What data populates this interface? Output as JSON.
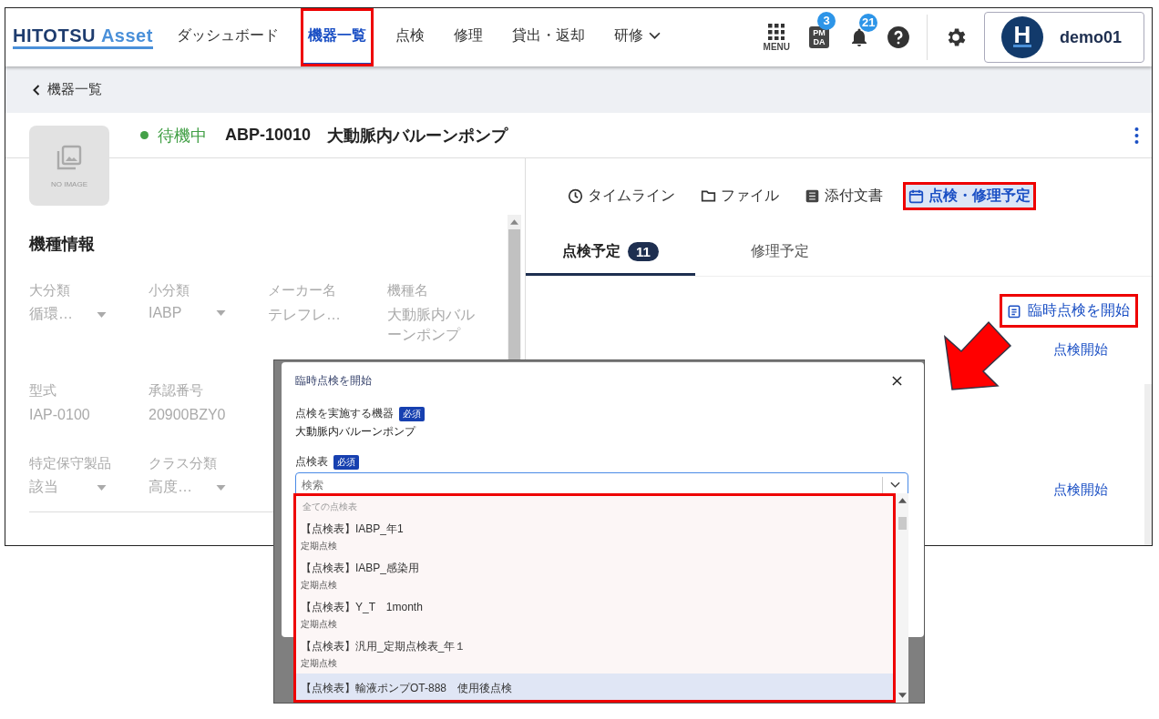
{
  "header": {
    "logo": {
      "main": "HITOTSU",
      "accent": "Asset"
    },
    "nav": [
      {
        "label": "ダッシュボード",
        "kind": "link",
        "selected": false,
        "highlighted": false
      },
      {
        "label": "機器一覧",
        "kind": "link",
        "selected": true,
        "highlighted": true
      },
      {
        "label": "点検",
        "kind": "link",
        "selected": false,
        "highlighted": false
      },
      {
        "label": "修理",
        "kind": "link",
        "selected": false,
        "highlighted": false
      },
      {
        "label": "貸出・返却",
        "kind": "link",
        "selected": false,
        "highlighted": false
      },
      {
        "label": "研修",
        "kind": "dropdown",
        "selected": false,
        "highlighted": false
      }
    ],
    "menu_label": "MENU",
    "pmda": {
      "lines": [
        "PM",
        "DA"
      ],
      "count": "3"
    },
    "notifications": {
      "count": "21"
    },
    "user": {
      "avatar_letter": "H",
      "name": "demo01"
    }
  },
  "breadcrumb": {
    "back": "機器一覧"
  },
  "device": {
    "status": {
      "label": "待機中",
      "color": "#43a047"
    },
    "code": "ABP-10010",
    "name": "大動脈内バルーンポンプ",
    "image_placeholder": "NO IMAGE"
  },
  "model_info": {
    "title": "機種情報",
    "rows": [
      [
        {
          "label": "大分類",
          "value": "循環…",
          "kind": "select"
        },
        {
          "label": "小分類",
          "value": "IABP",
          "kind": "select"
        },
        {
          "label": "メーカー名",
          "value": "テレフレ…",
          "kind": "text"
        },
        {
          "label": "機種名",
          "value": "大動脈内バルーンポンプ",
          "kind": "text"
        }
      ],
      [
        {
          "label": "型式",
          "value": "IAP-0100",
          "kind": "text"
        },
        {
          "label": "承認番号",
          "value": "20900BZY0",
          "kind": "text"
        }
      ],
      [
        {
          "label": "特定保守製品",
          "value": "該当",
          "kind": "select"
        },
        {
          "label": "クラス分類",
          "value": "高度…",
          "kind": "select"
        }
      ]
    ]
  },
  "view_tabs": [
    {
      "label": "タイムライン",
      "selected": false,
      "highlighted": false
    },
    {
      "label": "ファイル",
      "selected": false,
      "highlighted": false
    },
    {
      "label": "添付文書",
      "selected": false,
      "highlighted": false
    },
    {
      "label": "点検・修理予定",
      "selected": true,
      "highlighted": true
    }
  ],
  "schedule_tabs": [
    {
      "label": "点検予定",
      "count": "11",
      "selected": true
    },
    {
      "label": "修理予定",
      "selected": false
    }
  ],
  "start_button": {
    "label": "臨時点検を開始",
    "highlighted": true
  },
  "schedule_rows": [
    {
      "action": "点検開始"
    },
    {
      "action": "点検開始"
    }
  ],
  "dialog": {
    "title": "臨時点検を開始",
    "device_field": {
      "label": "点検を実施する機器",
      "badge": "必須",
      "value": "大動脈内バルーンポンプ"
    },
    "sheet_field": {
      "label": "点検表",
      "badge": "必須",
      "placeholder": "検索"
    },
    "dropdown": {
      "highlighted": true,
      "group": "全ての点検表",
      "options": [
        {
          "title": "【点検表】IABP_年1",
          "sub": "定期点検",
          "selected": false
        },
        {
          "title": "【点検表】IABP_感染用",
          "sub": "定期点検",
          "selected": false
        },
        {
          "title": "【点検表】Y_T　1month",
          "sub": "定期点検",
          "selected": false
        },
        {
          "title": "【点検表】汎用_定期点検表_年１",
          "sub": "定期点検",
          "selected": false
        },
        {
          "title": "【点検表】輸液ポンプOT-888　使用後点検",
          "selected": true
        }
      ]
    }
  }
}
